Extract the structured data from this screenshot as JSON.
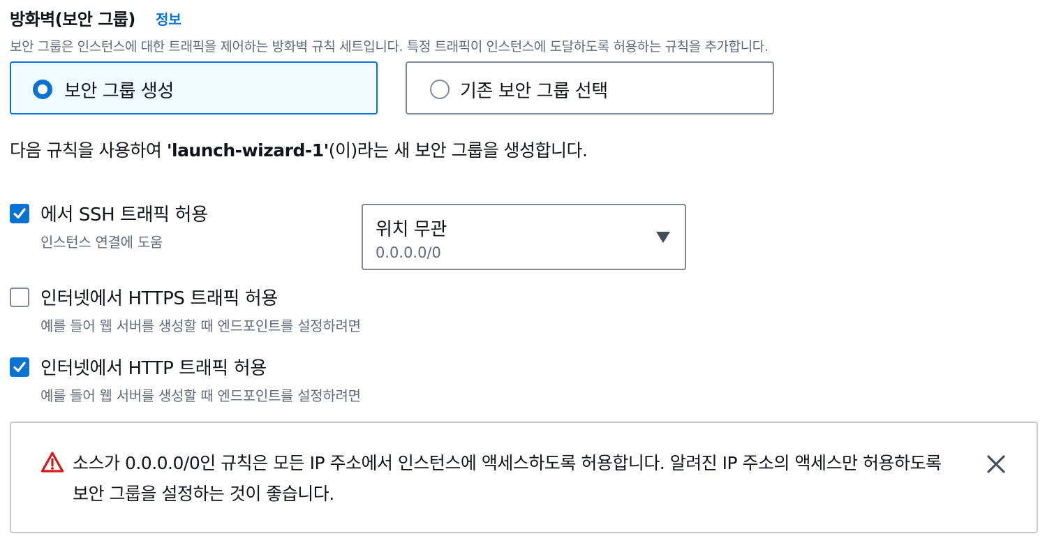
{
  "header": {
    "title": "방화벽(보안 그룹)",
    "info_link": "정보",
    "description": "보안 그룹은 인스턴스에 대한 트래픽을 제어하는 방화벽 규칙 세트입니다. 특정 트래픽이 인스턴스에 도달하도록 허용하는 규칙을 추가합니다."
  },
  "tiles": {
    "create": {
      "label": "보안 그룹 생성",
      "selected": true
    },
    "existing": {
      "label": "기존 보안 그룹 선택",
      "selected": false
    }
  },
  "intro": {
    "prefix": "다음 규칙을 사용하여 ",
    "group_name": "'launch-wizard-1'",
    "suffix": "(이)라는 새 보안 그룹을 생성합니다."
  },
  "rules": {
    "ssh": {
      "label": "에서 SSH 트래픽 허용",
      "description": "인스턴스 연결에 도움",
      "checked": true
    },
    "https": {
      "label": "인터넷에서 HTTPS 트래픽 허용",
      "description": "예를 들어 웹 서버를 생성할 때 엔드포인트를 설정하려면",
      "checked": false
    },
    "http": {
      "label": "인터넷에서 HTTP 트래픽 허용",
      "description": "예를 들어 웹 서버를 생성할 때 엔드포인트를 설정하려면",
      "checked": true
    }
  },
  "ssh_source_select": {
    "value": "위치 무관",
    "detail": "0.0.0.0/0"
  },
  "alert": {
    "type": "warning",
    "message": "소스가 0.0.0.0/0인 규칙은 모든 IP 주소에서 인스턴스에 액세스하도록 허용합니다. 알려진 IP 주소의 액세스만 허용하도록 보안 그룹을 설정하는 것이 좋습니다."
  },
  "colors": {
    "accent": "#0972d3",
    "selected_tile_bg": "#f0fbff",
    "warning": "#d91515",
    "secondary_text": "#5f6b7a"
  },
  "icons": {
    "checkbox_checked": "check-icon",
    "select_caret": "caret-down-icon",
    "warning": "warning-icon",
    "dismiss": "close-icon"
  }
}
